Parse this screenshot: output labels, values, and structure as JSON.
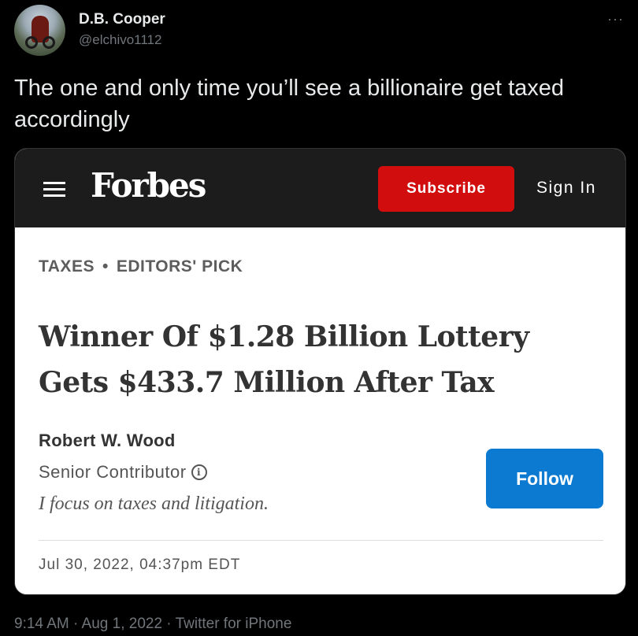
{
  "tweet": {
    "display_name": "D.B. Cooper",
    "handle": "@elchivo1112",
    "more_icon": "more-horizontal-icon",
    "text": "The one and only time you’ll see a billionaire get taxed accordingly",
    "meta": "9:14 AM · Aug 1, 2022 · Twitter for iPhone"
  },
  "forbes": {
    "logo": "Forbes",
    "menu_icon": "hamburger-menu-icon",
    "subscribe_label": "Subscribe",
    "signin_label": "Sign In",
    "accent_color": "#d10d0d",
    "category_primary": "TAXES",
    "category_separator": "•",
    "category_secondary": "EDITORS' PICK",
    "headline": "Winner Of $1.28 Billion Lottery Gets $433.7 Million After Tax",
    "author": "Robert W. Wood",
    "role": "Senior Contributor",
    "info_icon": "info-icon",
    "bio": "I focus on taxes and litigation.",
    "follow_label": "Follow",
    "follow_color": "#0d7ad1",
    "date": "Jul 30, 2022, 04:37pm EDT"
  }
}
